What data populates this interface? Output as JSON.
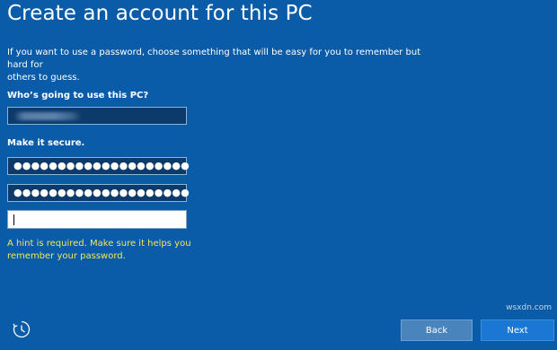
{
  "page": {
    "title": "Create an account for this PC",
    "intro": "If you want to use a password, choose something that will be easy for you to remember but hard for\nothers to guess."
  },
  "form": {
    "who_label": "Who’s going to use this PC?",
    "username_value": "",
    "secure_label": "Make it secure.",
    "password_mask": "●●●●●●●●●●●●●●●●●●●●",
    "confirm_mask": "●●●●●●●●●●●●●●●●●●●●",
    "hint_value": "",
    "error_message": "A hint is required. Make sure it helps you\nremember your password."
  },
  "footer": {
    "accessibility_icon": "ease-of-access-icon",
    "back_label": "Back",
    "next_label": "Next"
  },
  "watermark": "wsxdn.com",
  "colors": {
    "background": "#0a5ca8",
    "field_dark": "#0c3a6b",
    "error_yellow": "#f2e85a",
    "next_button": "#1a78d4",
    "back_button": "#4a84bd"
  }
}
